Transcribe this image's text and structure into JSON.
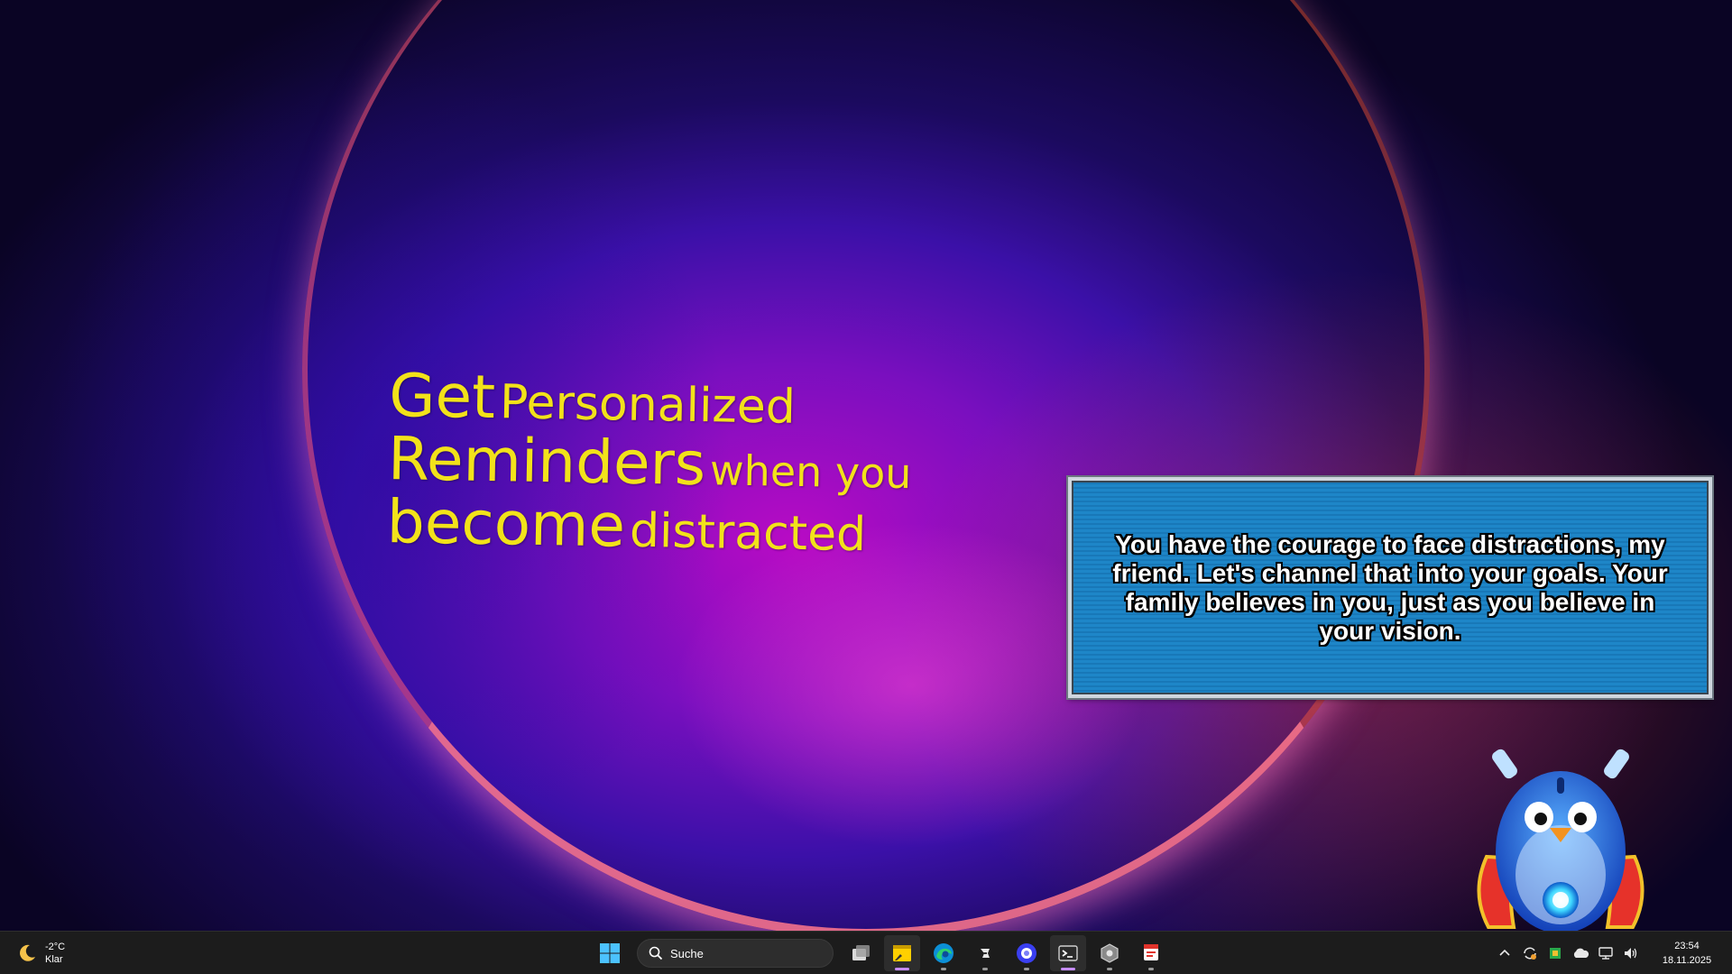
{
  "promo": {
    "line1_big": "Get",
    "line1_mid": "Personalized",
    "line2_big": "Reminders",
    "line2_small": "when you",
    "line3_big": "become",
    "line3_mid": "distracted"
  },
  "message": {
    "text": "You have the courage to face distractions, my friend. Let's channel that into your goals. Your family believes in you, just as you believe in your vision."
  },
  "taskbar": {
    "weather": {
      "temperature": "-2°C",
      "condition": "Klar",
      "icon": "moon-icon"
    },
    "search": {
      "placeholder": "Suche"
    },
    "apps": [
      {
        "name": "start",
        "icon": "windows-start-icon"
      },
      {
        "name": "task-view",
        "icon": "task-view-icon"
      },
      {
        "name": "sticky-notes",
        "icon": "sticky-notes-icon",
        "active": true
      },
      {
        "name": "edge",
        "icon": "edge-browser-icon"
      },
      {
        "name": "app-dark",
        "icon": "dark-app-icon"
      },
      {
        "name": "app-blue-circle",
        "icon": "blue-circle-app-icon"
      },
      {
        "name": "terminal",
        "icon": "terminal-icon",
        "active": true
      },
      {
        "name": "settings-cube",
        "icon": "cube-settings-icon"
      },
      {
        "name": "app-red",
        "icon": "red-app-icon"
      }
    ],
    "tray": [
      "chevron-up-icon",
      "sync-icon",
      "app-tray-icon",
      "cloud-icon",
      "network-icon",
      "volume-icon"
    ],
    "clock": {
      "time": "23:54",
      "date": "18.11.2025"
    }
  },
  "colors": {
    "promo_text": "#f2e21a",
    "message_bg": "#1e86c8",
    "taskbar_bg": "#1c1c1c"
  }
}
